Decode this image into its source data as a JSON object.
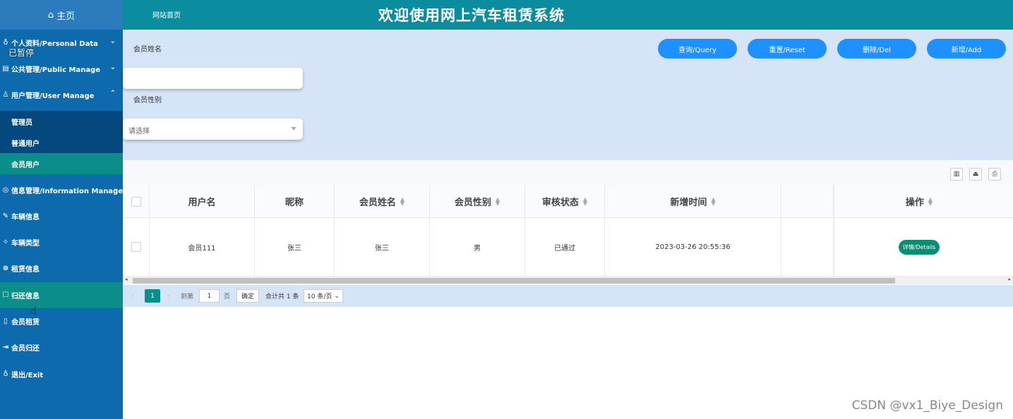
{
  "sidebar": {
    "home_label": "主页",
    "paused_overlay": "已暂停",
    "items": [
      {
        "label": "个人资料/Personal Data",
        "icon": "user-icon",
        "chevron": "⌄"
      },
      {
        "label": "公共管理/Public Manage",
        "icon": "board-icon",
        "chevron": "⌄"
      },
      {
        "label": "用户管理/User Manage",
        "icon": "users-icon",
        "chevron": "⌃"
      },
      {
        "label": "信息管理/Information Manage",
        "icon": "info-icon",
        "chevron": "⌄"
      },
      {
        "label": "车辆信息",
        "icon": "car-icon"
      },
      {
        "label": "车辆类型",
        "icon": "tag-icon"
      },
      {
        "label": "租赁信息",
        "icon": "rent-icon"
      },
      {
        "label": "归还信息",
        "icon": "return-icon"
      },
      {
        "label": "会员租赁",
        "icon": "member-rent-icon"
      },
      {
        "label": "会员归还",
        "icon": "member-return-icon"
      },
      {
        "label": "退出/Exit",
        "icon": "exit-icon"
      }
    ],
    "subitems": [
      "管理员",
      "普通用户",
      "会员用户"
    ]
  },
  "header": {
    "home_link": "网站首页",
    "title": "欢迎使用网上汽车租赁系统"
  },
  "search": {
    "name_label": "会员姓名",
    "gender_label": "会员性别",
    "gender_placeholder": "请选择",
    "buttons": {
      "query": "查询/Query",
      "reset": "重置/Reset",
      "delete": "删除/Del",
      "add": "新增/Add"
    }
  },
  "table": {
    "columns": [
      "用户名",
      "昵称",
      "会员姓名",
      "会员性别",
      "审核状态",
      "新增时间",
      "",
      "操作"
    ],
    "rows": [
      {
        "username": "会员111",
        "nickname": "张三",
        "name": "张三",
        "gender": "男",
        "status": "已通过",
        "created": "2023-03-26 20:55:36",
        "action": "详情/Details"
      }
    ]
  },
  "pager": {
    "current": "1",
    "goto_label": "到第",
    "page_input": "1",
    "page_unit": "页",
    "confirm": "确定",
    "total": "合计共 1 条",
    "page_size": "10 条/页"
  },
  "watermark": "CSDN @vx1_Biye_Design"
}
